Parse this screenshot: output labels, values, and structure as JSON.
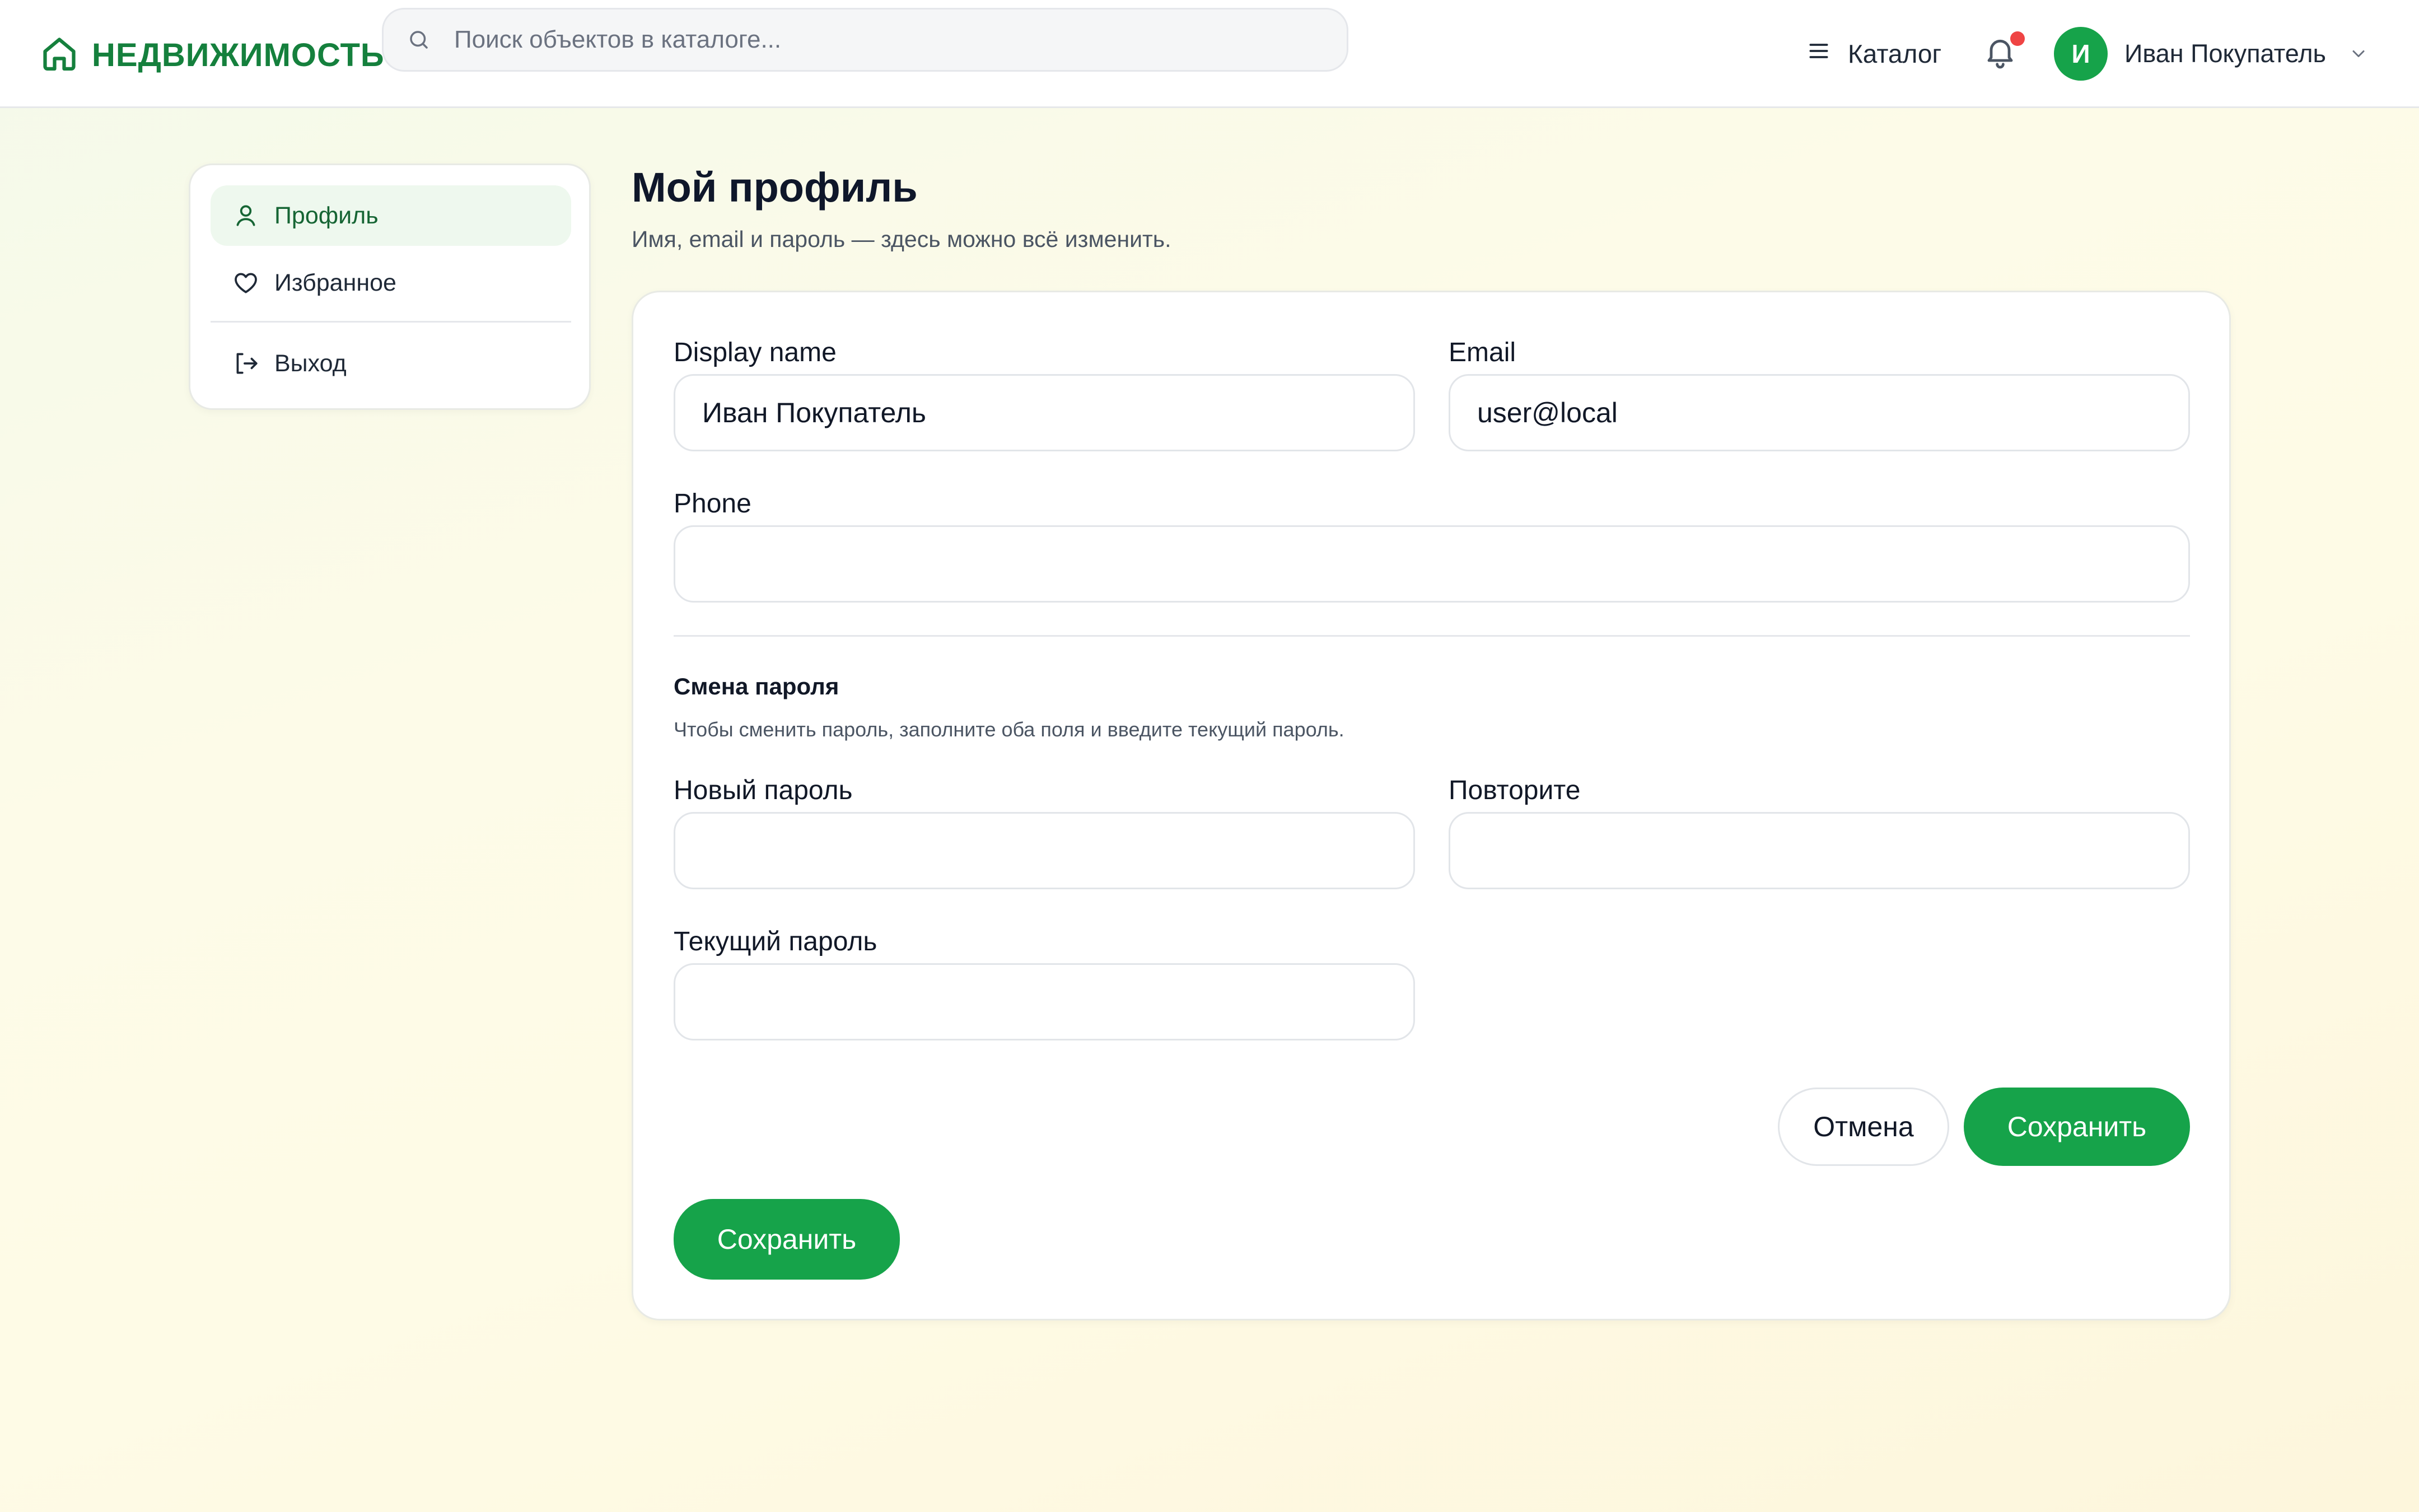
{
  "header": {
    "logo_text": "НЕДВИЖИМОСТЬ",
    "search_placeholder": "Поиск объектов в каталоге...",
    "catalog_label": "Каталог",
    "has_notifications": true,
    "user_initial": "И",
    "user_name": "Иван Покупатель"
  },
  "sidebar": {
    "items": [
      {
        "label": "Профиль",
        "icon": "user-icon",
        "active": true
      },
      {
        "label": "Избранное",
        "icon": "heart-icon",
        "active": false
      },
      {
        "label": "Выход",
        "icon": "logout-icon",
        "active": false
      }
    ]
  },
  "page": {
    "title": "Мой профиль",
    "subtitle": "Имя, email и пароль — здесь можно всё изменить."
  },
  "form": {
    "display_name": {
      "label": "Display name",
      "value": "Иван Покупатель"
    },
    "email": {
      "label": "Email",
      "value": "user@local"
    },
    "phone": {
      "label": "Phone",
      "value": ""
    },
    "password_section": {
      "title": "Смена пароля",
      "hint": "Чтобы сменить пароль, заполните оба поля и введите текущий пароль."
    },
    "new_password": {
      "label": "Новый пароль",
      "value": ""
    },
    "repeat_password": {
      "label": "Повторите",
      "value": ""
    },
    "current_password": {
      "label": "Текущий пароль",
      "value": ""
    },
    "cancel_label": "Отмена",
    "save_label": "Сохранить",
    "save_bottom_label": "Сохранить"
  },
  "colors": {
    "brand": "#16a34a",
    "brand_dark": "#15803d",
    "notification_dot": "#ef4444",
    "active_item_bg": "#eef8ee"
  }
}
